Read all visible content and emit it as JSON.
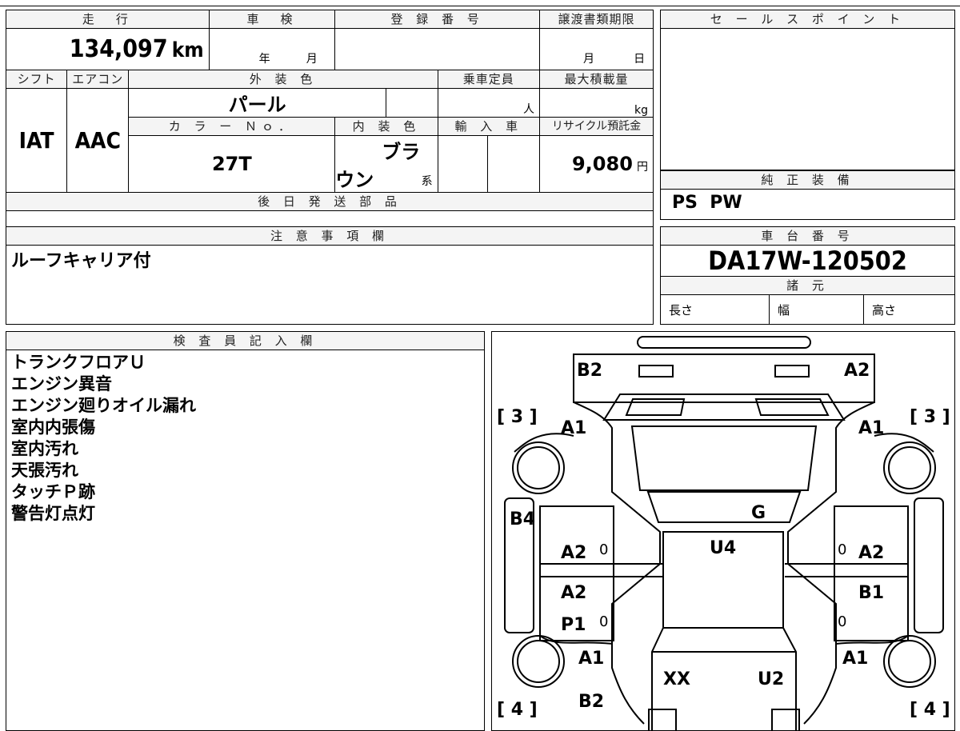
{
  "top_table": {
    "mileage_header": "走　行",
    "mileage_value": "134,097",
    "mileage_unit": "km",
    "inspection_header": "車　検",
    "inspection_year": "年",
    "inspection_month": "月",
    "registration_header": "登 録 番 号",
    "transfer_header": "譲渡書類期限",
    "transfer_month": "月",
    "transfer_day": "日",
    "shift_header": "シフト",
    "aircon_header": "エアコン",
    "exterior_header": "外 装 色",
    "capacity_header": "乗車定員",
    "capacity_unit": "人",
    "load_header": "最大積載量",
    "load_unit": "kg",
    "shift_value": "IAT",
    "aircon_value": "AAC",
    "exterior_value": "パール",
    "color_no_header": "カ ラ ー Ｎｏ．",
    "interior_header": "内 装 色",
    "import_header": "輸 入 車",
    "recycle_header": "リサイクル預託金",
    "color_no_value": "27T",
    "interior_value": "ブラウン",
    "interior_suffix": "系",
    "recycle_value": "9,080",
    "recycle_unit": "円",
    "later_parts_header": "後 日 発 送 部 品"
  },
  "sales_point": {
    "header": "セ ー ル ス ポ イ ン ト"
  },
  "genuine_equipment": {
    "header": "純 正 装 備",
    "value": "PS  PW"
  },
  "notes": {
    "header": "注 意 事 項 欄",
    "value": "ルーフキャリア付"
  },
  "chassis": {
    "header": "車 台 番 号",
    "value": "DA17W-120502",
    "spec_header": "諸 元",
    "length_label": "長さ",
    "width_label": "幅",
    "height_label": "高さ"
  },
  "inspector": {
    "header": "検 査 員 記 入 欄",
    "lines": [
      "トランクフロアＵ",
      "エンジン異音",
      "エンジン廻りオイル漏れ",
      "室内内張傷",
      "室内汚れ",
      "天張汚れ",
      "タッチＰ跡",
      "警告灯点灯"
    ]
  },
  "diagram": {
    "bracket_tl": "[ 3 ]",
    "bracket_tr": "[ 3 ]",
    "bracket_bl": "[ 4 ]",
    "bracket_br": "[ 4 ]",
    "rear_left": "B2",
    "rear_right": "A2",
    "quarter_left": "A1",
    "quarter_right": "A1",
    "roof": "G",
    "side_left": "B4",
    "center": "U4",
    "door_rl": "A2",
    "door_rr": "A2",
    "door_fl": "A2",
    "door_fr": "B1",
    "sill_fl": "P1",
    "fender_fl": "A1",
    "fender_fr": "A1",
    "hood_left": "XX",
    "hood_right": "U2",
    "bumper_front": "B2",
    "zero1": "0",
    "zero2": "0",
    "zero3": "0",
    "zero4": "0"
  }
}
